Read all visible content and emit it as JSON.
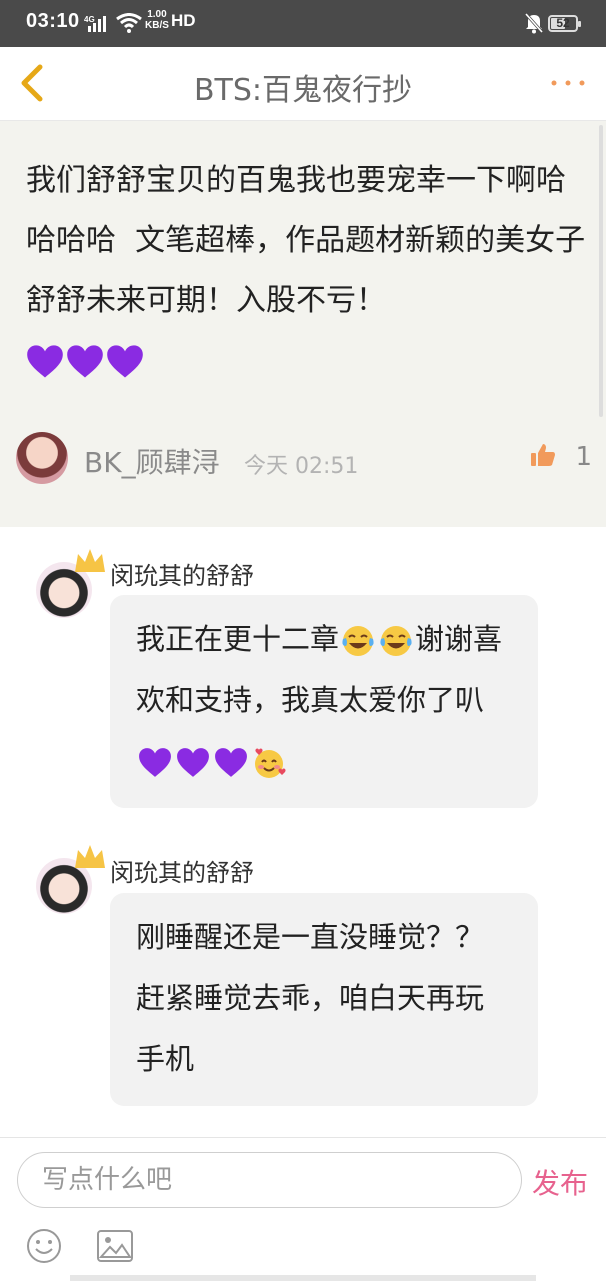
{
  "status_bar": {
    "time": "03:10",
    "network": "4G",
    "speed_value": "1.00",
    "speed_unit": "KB/S",
    "hd": "HD",
    "battery": "52"
  },
  "nav": {
    "title": "BTS:百鬼夜行抄",
    "back_icon": "chevron-left-icon",
    "more_icon": "more-dots-icon"
  },
  "main_comment": {
    "text": "我们舒舒宝贝的百鬼我也要宠幸一下啊哈哈哈哈  文笔超棒，作品题材新颖的美女子舒舒未来可期！入股不亏！",
    "hearts": [
      "purple-heart",
      "purple-heart",
      "purple-heart"
    ],
    "author": "BK_顾肆浔",
    "time": "今天 02:51",
    "likes": "1"
  },
  "replies": [
    {
      "name": "闵玧其的舒舒",
      "text_1": "我正在更十二章",
      "text_2": "谢谢喜欢和支持，我真太爱你了叭",
      "emojis_1": [
        "laugh-cry-emoji",
        "laugh-cry-emoji"
      ],
      "emojis_2": [
        "purple-heart",
        "purple-heart",
        "purple-heart",
        "smiling-hearts-emoji"
      ]
    },
    {
      "name": "闵玧其的舒舒",
      "text": "刚睡醒还是一直没睡觉？？赶紧睡觉去乖，咱白天再玩手机"
    }
  ],
  "input_bar": {
    "placeholder": "写点什么吧",
    "publish": "发布"
  },
  "colors": {
    "accent": "#e7628e",
    "like": "#f19a5b",
    "heart": "#8a2be2"
  }
}
